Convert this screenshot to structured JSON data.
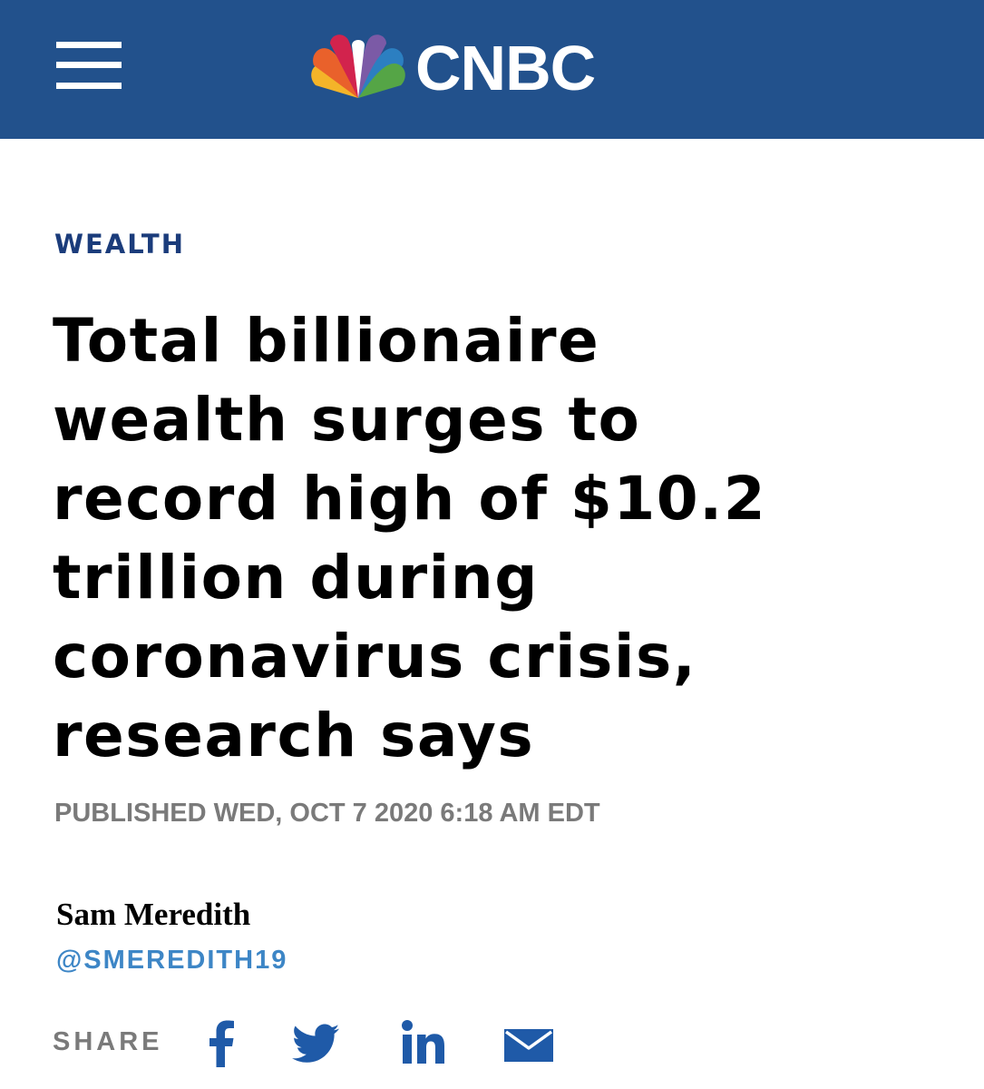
{
  "header": {
    "brand_name": "CNBC",
    "menu_icon": "hamburger-menu-icon",
    "logo_icon": "nbc-peacock-icon",
    "background_color": "#22518c"
  },
  "article": {
    "section": "WEALTH",
    "headline_lines": [
      "Total billionaire",
      "wealth surges to",
      "record high of $10.2",
      "trillion during",
      "coronavirus crisis,",
      "research says"
    ],
    "published": "PUBLISHED WED, OCT 7 2020 6:18 AM EDT",
    "author": {
      "name": "Sam Meredith",
      "handle": "@SMEREDITH19"
    }
  },
  "share": {
    "label": "SHARE",
    "icons": [
      "facebook-icon",
      "twitter-icon",
      "linkedin-icon",
      "email-icon"
    ]
  },
  "colors": {
    "section_label": "#1b3c7b",
    "handle": "#3d86c6",
    "meta_gray": "#7a7a7a",
    "share_blue": "#1f5aa8"
  }
}
